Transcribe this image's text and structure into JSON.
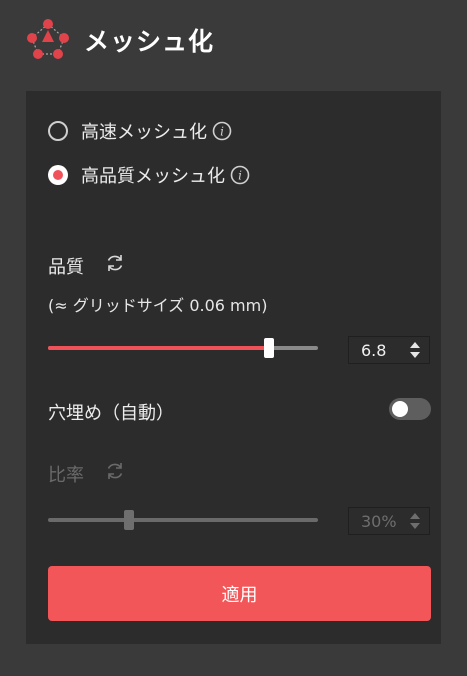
{
  "app": {
    "title": "メッシュ化",
    "logo": "mesh-logo-icon"
  },
  "mode": {
    "options": [
      {
        "label": "高速メッシュ化",
        "selected": false,
        "icon": "info-icon"
      },
      {
        "label": "高品質メッシュ化",
        "selected": true,
        "icon": "info-icon"
      }
    ]
  },
  "quality": {
    "label": "品質",
    "reset_icon": "refresh-icon",
    "hint": "(≈ グリッドサイズ 0.06 mm)",
    "slider_fraction": 0.82,
    "value": "6.8"
  },
  "fill_holes": {
    "label": "穴埋め（自動）",
    "enabled": false
  },
  "ratio": {
    "label": "比率",
    "reset_icon": "refresh-icon",
    "disabled": true,
    "slider_fraction": 0.3,
    "value": "30%"
  },
  "apply": {
    "label": "適用"
  },
  "colors": {
    "accent": "#f35658",
    "panel": "#2c2c2c",
    "background": "#3a3a3a"
  }
}
